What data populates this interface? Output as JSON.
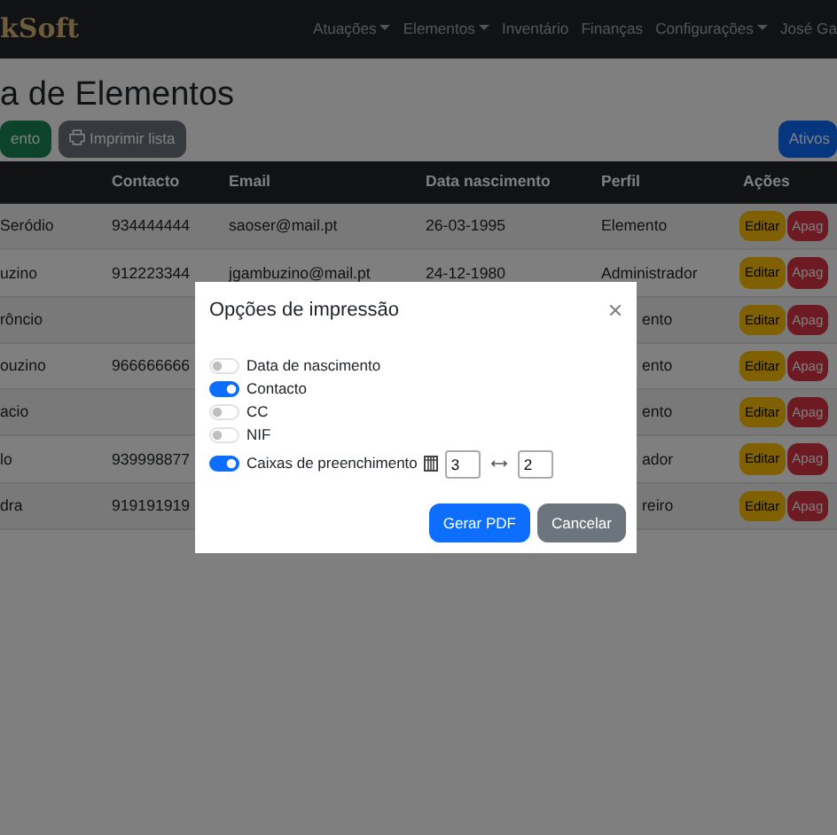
{
  "navbar": {
    "brand": "kSoft",
    "items": [
      {
        "label": "Atuações",
        "dropdown": true
      },
      {
        "label": "Elementos",
        "dropdown": true
      },
      {
        "label": "Inventário",
        "dropdown": false
      },
      {
        "label": "Finanças",
        "dropdown": false
      },
      {
        "label": "Configurações",
        "dropdown": true
      },
      {
        "label": "José Ga",
        "dropdown": false
      }
    ]
  },
  "page_title": "a de Elementos",
  "toolbar": {
    "buttons": [
      {
        "label": "ento",
        "kind": "success"
      },
      {
        "label": "Imprimir lista",
        "kind": "print"
      }
    ],
    "right_button": "Ativos"
  },
  "table": {
    "columns": [
      "Contacto",
      "Email",
      "Data nascimento",
      "Perfil",
      "Ações"
    ],
    "rows": [
      {
        "kind": "full",
        "column_1": "Seródio",
        "contacto": "934444444",
        "email": "saoser@mail.pt",
        "data_nascimento": "26-03-1995",
        "perfil": "Elemento",
        "actions": [
          "Editar",
          "Apag"
        ]
      },
      {
        "kind": "full",
        "column_1": "uzino",
        "contacto": "912223344",
        "email": "jgambuzino@mail.pt",
        "data_nascimento": "24-12-1980",
        "perfil": "Administrador",
        "actions": [
          "Editar",
          "Apag"
        ]
      },
      {
        "kind": "partly_hidden",
        "column_1": "rôncio",
        "perfil": "ento",
        "actions": [
          "Editar",
          "Apag"
        ]
      },
      {
        "kind": "partly_hidden",
        "column_1": "ouzino",
        "contacto": "966666666",
        "perfil": "ento",
        "actions": [
          "Editar",
          "Apag"
        ]
      },
      {
        "kind": "partly_hidden",
        "column_1": "acio",
        "perfil": "ento",
        "actions": [
          "Editar",
          "Apag"
        ]
      },
      {
        "kind": "partly_hidden",
        "column_1": "lo",
        "contacto": "939998877",
        "perfil": "ador",
        "actions": [
          "Editar",
          "Apag"
        ]
      },
      {
        "kind": "partly_hidden",
        "column_1": "dra",
        "contacto": "919191919",
        "perfil": "reiro",
        "actions": [
          "Editar",
          "Apag"
        ]
      }
    ]
  },
  "modal": {
    "title": "Opções de impressão",
    "options": [
      {
        "kind": "switch",
        "label": "Data de nascimento",
        "on": false
      },
      {
        "kind": "switch",
        "label": "Contacto",
        "on": true
      },
      {
        "kind": "switch",
        "label": "CC",
        "on": false
      },
      {
        "kind": "switch",
        "label": "NIF",
        "on": false
      },
      {
        "kind": "switch_with_sizes",
        "label": "Caixas de preenchimento",
        "on": true,
        "columns_value": "3",
        "rows_value": "2"
      }
    ],
    "buttons": [
      {
        "label": "Gerar PDF",
        "kind": "primary"
      },
      {
        "label": "Cancelar",
        "kind": "secondary"
      }
    ]
  }
}
